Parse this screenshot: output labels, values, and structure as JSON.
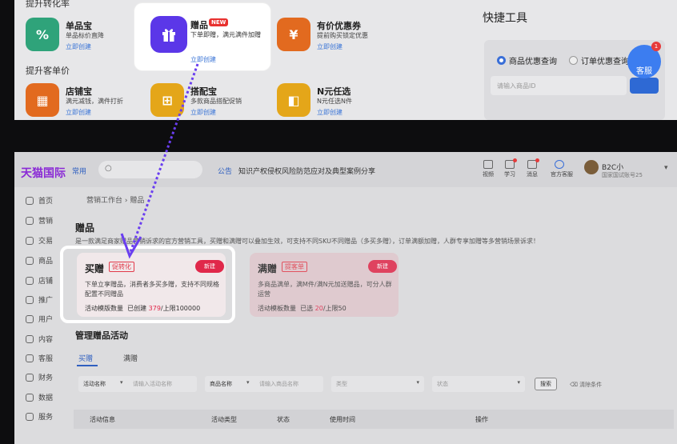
{
  "top": {
    "section1_title": "提升转化率",
    "section2_title": "提升客单价",
    "tools": [
      {
        "name": "单品宝",
        "desc": "单品标价直降",
        "link": "立即创建",
        "color": "#2fa37a"
      },
      {
        "name": "有价优惠券",
        "desc": "提前购买锁定优惠",
        "link": "立即创建",
        "color": "#e26a1f"
      },
      {
        "name": "店铺宝",
        "desc": "满元减钱，满件打折",
        "link": "立即创建",
        "color": "#e26a1f"
      },
      {
        "name": "搭配宝",
        "desc": "多款商品搭配促销",
        "link": "立即创建",
        "color": "#e4a619"
      },
      {
        "name": "N元任选",
        "desc": "N元任选N件",
        "link": "立即创建",
        "color": "#e4a619"
      }
    ],
    "gift": {
      "name": "赠品",
      "badge": "NEW",
      "desc": "下单即赠，满元满件加赠",
      "link": "立即创建",
      "color": "#5b37e8"
    },
    "quick_tools": {
      "title": "快捷工具",
      "radio1": "商品优惠查询",
      "radio2": "订单优惠查询",
      "placeholder": "请输入商品ID"
    },
    "customer_service": {
      "label": "客服",
      "badge": "1"
    }
  },
  "app": {
    "logo": "天猫国际",
    "nav_common": "常用",
    "notice_label": "公告",
    "notice_text": "知识产权侵权风险防范应对及典型案例分享",
    "top_icons": [
      {
        "label": "视频",
        "dot": false
      },
      {
        "label": "学习",
        "dot": true
      },
      {
        "label": "消息",
        "dot": true
      },
      {
        "label": "官方客服",
        "dot": false
      }
    ],
    "user": {
      "name": "B2C小",
      "sub": "国家国试账号25"
    },
    "sidebar": [
      "首页",
      "营销",
      "交易",
      "商品",
      "店铺",
      "推广",
      "用户",
      "内容",
      "客服",
      "财务",
      "数据",
      "服务"
    ],
    "breadcrumb": "营销工作台  ›  赠品",
    "page_title": "赠品",
    "page_desc": "是一款满足商家赠品营销诉求的官方营销工具，买赠和满赠可以叠加生效，可支持不同SKU不同赠品（多买多赠），订单满额加赠，人群专享加赠等多营销场景诉求！",
    "cards": [
      {
        "title": "买赠",
        "tag": "促转化",
        "button": "新建",
        "desc": "下单立享赠品，消费者多买多赠，支持不同规格配置不同赠品",
        "count_label": "活动模版数量",
        "created_label": "已创建",
        "created": "379",
        "limit": "/上限100000"
      },
      {
        "title": "满赠",
        "tag": "提客单",
        "button": "新建",
        "desc": "多商品满单，满M件/满N元加送赠品，可分人群运营",
        "count_label": "活动模板数量",
        "created_label": "已选",
        "created": "20",
        "limit": "/上限50"
      }
    ],
    "manage_title": "管理赠品活动",
    "tabs": [
      "买赠",
      "满赠"
    ],
    "filters": [
      {
        "label": "活动名称",
        "placeholder": "请输入活动名称"
      },
      {
        "label": "商品名称",
        "placeholder": "请输入商品名称"
      },
      {
        "label": "",
        "placeholder": "类型"
      },
      {
        "label": "",
        "placeholder": "状态"
      }
    ],
    "search_button": "搜索",
    "clear_filters": "清除条件",
    "table_headers": [
      "活动信息",
      "活动类型",
      "状态",
      "使用时间",
      "操作"
    ]
  }
}
